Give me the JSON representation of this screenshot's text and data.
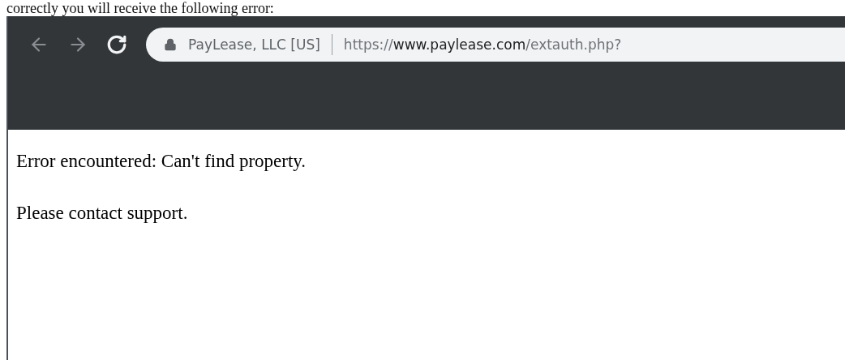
{
  "caption": "correctly you will receive the following error:",
  "browser": {
    "nav_buttons": [
      {
        "kind": "back",
        "disabled": true
      },
      {
        "kind": "forward",
        "disabled": true
      },
      {
        "kind": "reload",
        "disabled": false
      }
    ],
    "address_bar": {
      "site_identity": "PayLease, LLC [US]",
      "url": {
        "scheme": "https://",
        "host": "www.paylease.com",
        "path": "/extauth.php?"
      }
    }
  },
  "page": {
    "paragraphs": [
      "Error encountered: Can't find property.",
      "Please contact support."
    ]
  }
}
